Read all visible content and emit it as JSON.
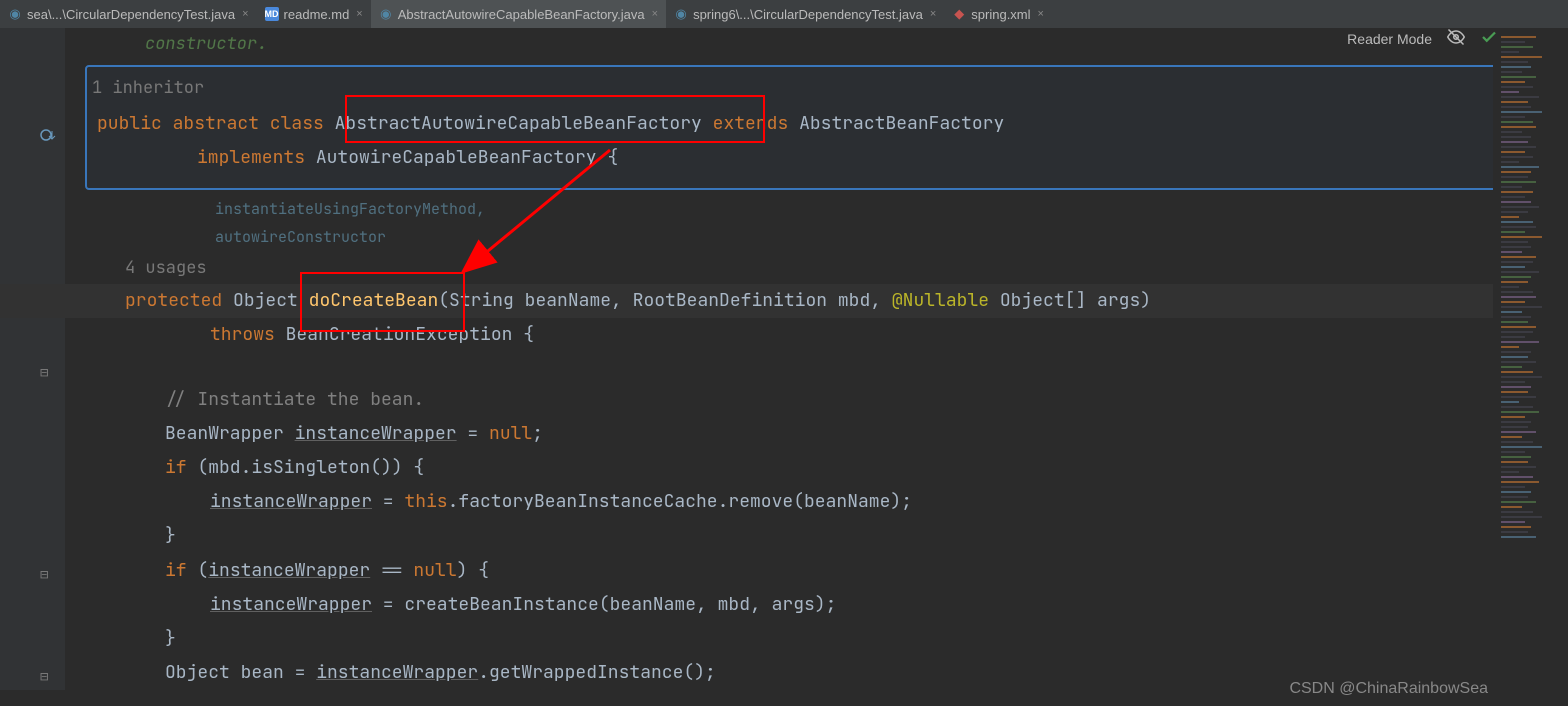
{
  "tabs": [
    {
      "icon": "java",
      "label": "sea\\...\\CircularDependencyTest.java"
    },
    {
      "icon": "md",
      "label": "readme.md"
    },
    {
      "icon": "java",
      "label": "AbstractAutowireCapableBeanFactory.java"
    },
    {
      "icon": "java",
      "label": "spring6\\...\\CircularDependencyTest.java"
    },
    {
      "icon": "xml",
      "label": "spring.xml"
    }
  ],
  "reader_mode": "Reader Mode",
  "comment_top": "constructor.",
  "inheritor": "1 inheritor",
  "class_decl": {
    "mods": "public abstract class",
    "name": "AbstractAutowireCapableBeanFactory",
    "extends": "extends",
    "parent": "AbstractBeanFactory",
    "impl": "implements",
    "iface": "AutowireCapableBeanFactory",
    "brace": "{"
  },
  "folded": {
    "l1": "instantiateUsingFactoryMethod,",
    "l2": "autowireConstructor"
  },
  "usages": "4 usages",
  "method": {
    "protected": "protected",
    "ret": "Object",
    "name": "doCreateBean",
    "sig1": "(String beanName, RootBeanDefinition mbd, ",
    "nullable": "@Nullable",
    "sig2": " Object[] args)",
    "throws": "throws",
    "exc": "BeanCreationException",
    "brace": "{"
  },
  "code": {
    "c1": "// Instantiate the bean.",
    "l1a": "BeanWrapper ",
    "l1b": "instanceWrapper",
    "l1c": " = ",
    "l1d": "null",
    "l1e": ";",
    "l2a": "if",
    "l2b": " (mbd.isSingleton()) {",
    "l3a": "instanceWrapper",
    "l3b": " = ",
    "l3c": "this",
    "l3d": ".factoryBeanInstanceCache.remove(beanName);",
    "l4": "}",
    "l5a": "if",
    "l5b": " (",
    "l5c": "instanceWrapper",
    "l5d": " == ",
    "l5e": "null",
    "l5f": ") {",
    "l6a": "instanceWrapper",
    "l6b": " = createBeanInstance(beanName, mbd, args);",
    "l7": "}",
    "l8a": "Object bean = ",
    "l8b": "instanceWrapper",
    "l8c": ".getWrappedInstance();"
  },
  "watermark": "CSDN @ChinaRainbowSea"
}
